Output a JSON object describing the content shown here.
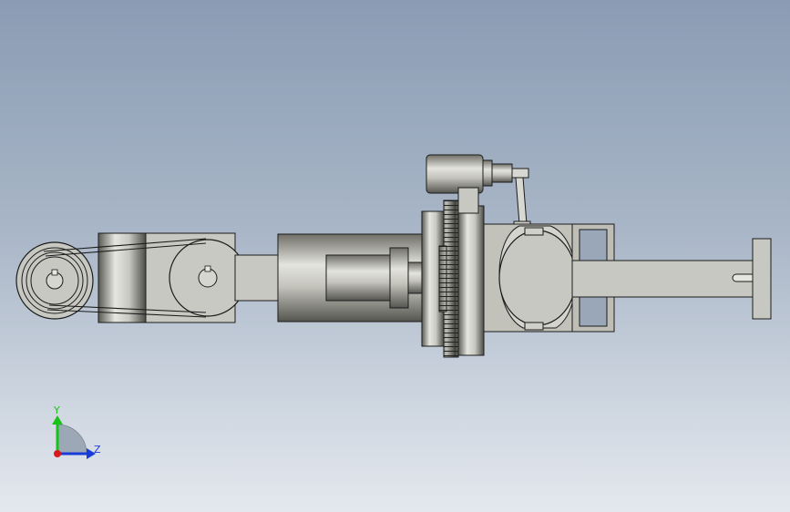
{
  "triad": {
    "y_label": "Y",
    "z_label": "Z",
    "y_color": "#19c219",
    "z_color": "#1a3cd8",
    "x_color": "#d81a1a"
  },
  "colors": {
    "background_top": "#8a9cb4",
    "background_bottom": "#e4e8ee",
    "part_fill": "#c9c9c3",
    "part_dark": "#3a3a36",
    "edge": "#1b1b1b"
  }
}
